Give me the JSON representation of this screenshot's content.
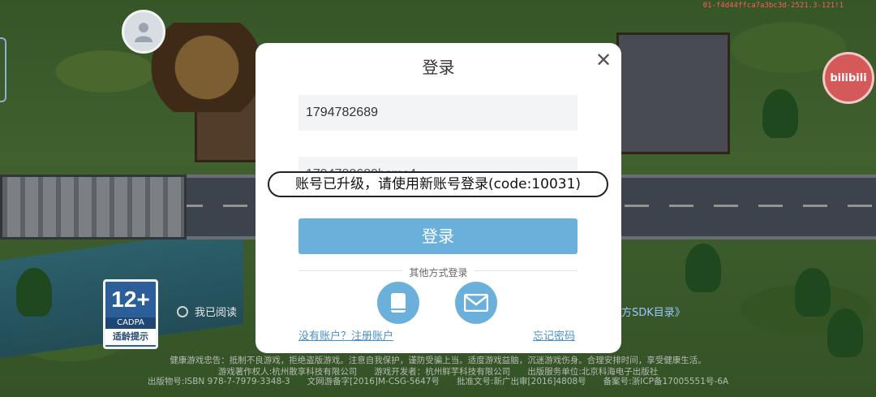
{
  "status": {
    "build_id": "01-f4d44ffca7a3bc3d-2521.3-121!1"
  },
  "brand": {
    "bili_label": "bilibili"
  },
  "icons": {
    "avatar": "user-avatar-icon",
    "close": "close-icon",
    "phone": "phone-icon",
    "mail": "mail-icon"
  },
  "colors": {
    "accent": "#6ab0db",
    "link": "#4a90c9",
    "dialog_bg": "#ffffff"
  },
  "age_rating": {
    "number": "12+",
    "org": "CADPA",
    "tip": "适龄提示"
  },
  "agreement": {
    "text": "我已阅读",
    "sdk_link": "方SDK目录》"
  },
  "dialog": {
    "title": "登录",
    "username_value": "1794782689",
    "password_value": "1794782689bsmc4",
    "login_button": "登录",
    "other_methods": "其他方式登录",
    "register_link": "没有账户？注册账户",
    "forgot_link": "忘记密码"
  },
  "toast": {
    "message": "账号已升级，请使用新账号登录(code:10031)"
  },
  "footer": {
    "line1": "健康游戏忠告：抵制不良游戏，拒绝盗版游戏。注意自我保护，谨防受骗上当。适度游戏益脑，沉迷游戏伤身。合理安排时间，享受健康生活。",
    "line2": "游戏著作权人:杭州散享科技有限公司　　游戏开发者：杭州鲜芋科技有限公司　　出版服务单位:北京科海电子出版社",
    "line3": "出版物号:ISBN 978-7-7979-3348-3　　文网游备字[2016]M-CSG-5647号　　批准文号:新广出审[2016]4808号　　备案号:浙ICP备17005551号-6A"
  }
}
